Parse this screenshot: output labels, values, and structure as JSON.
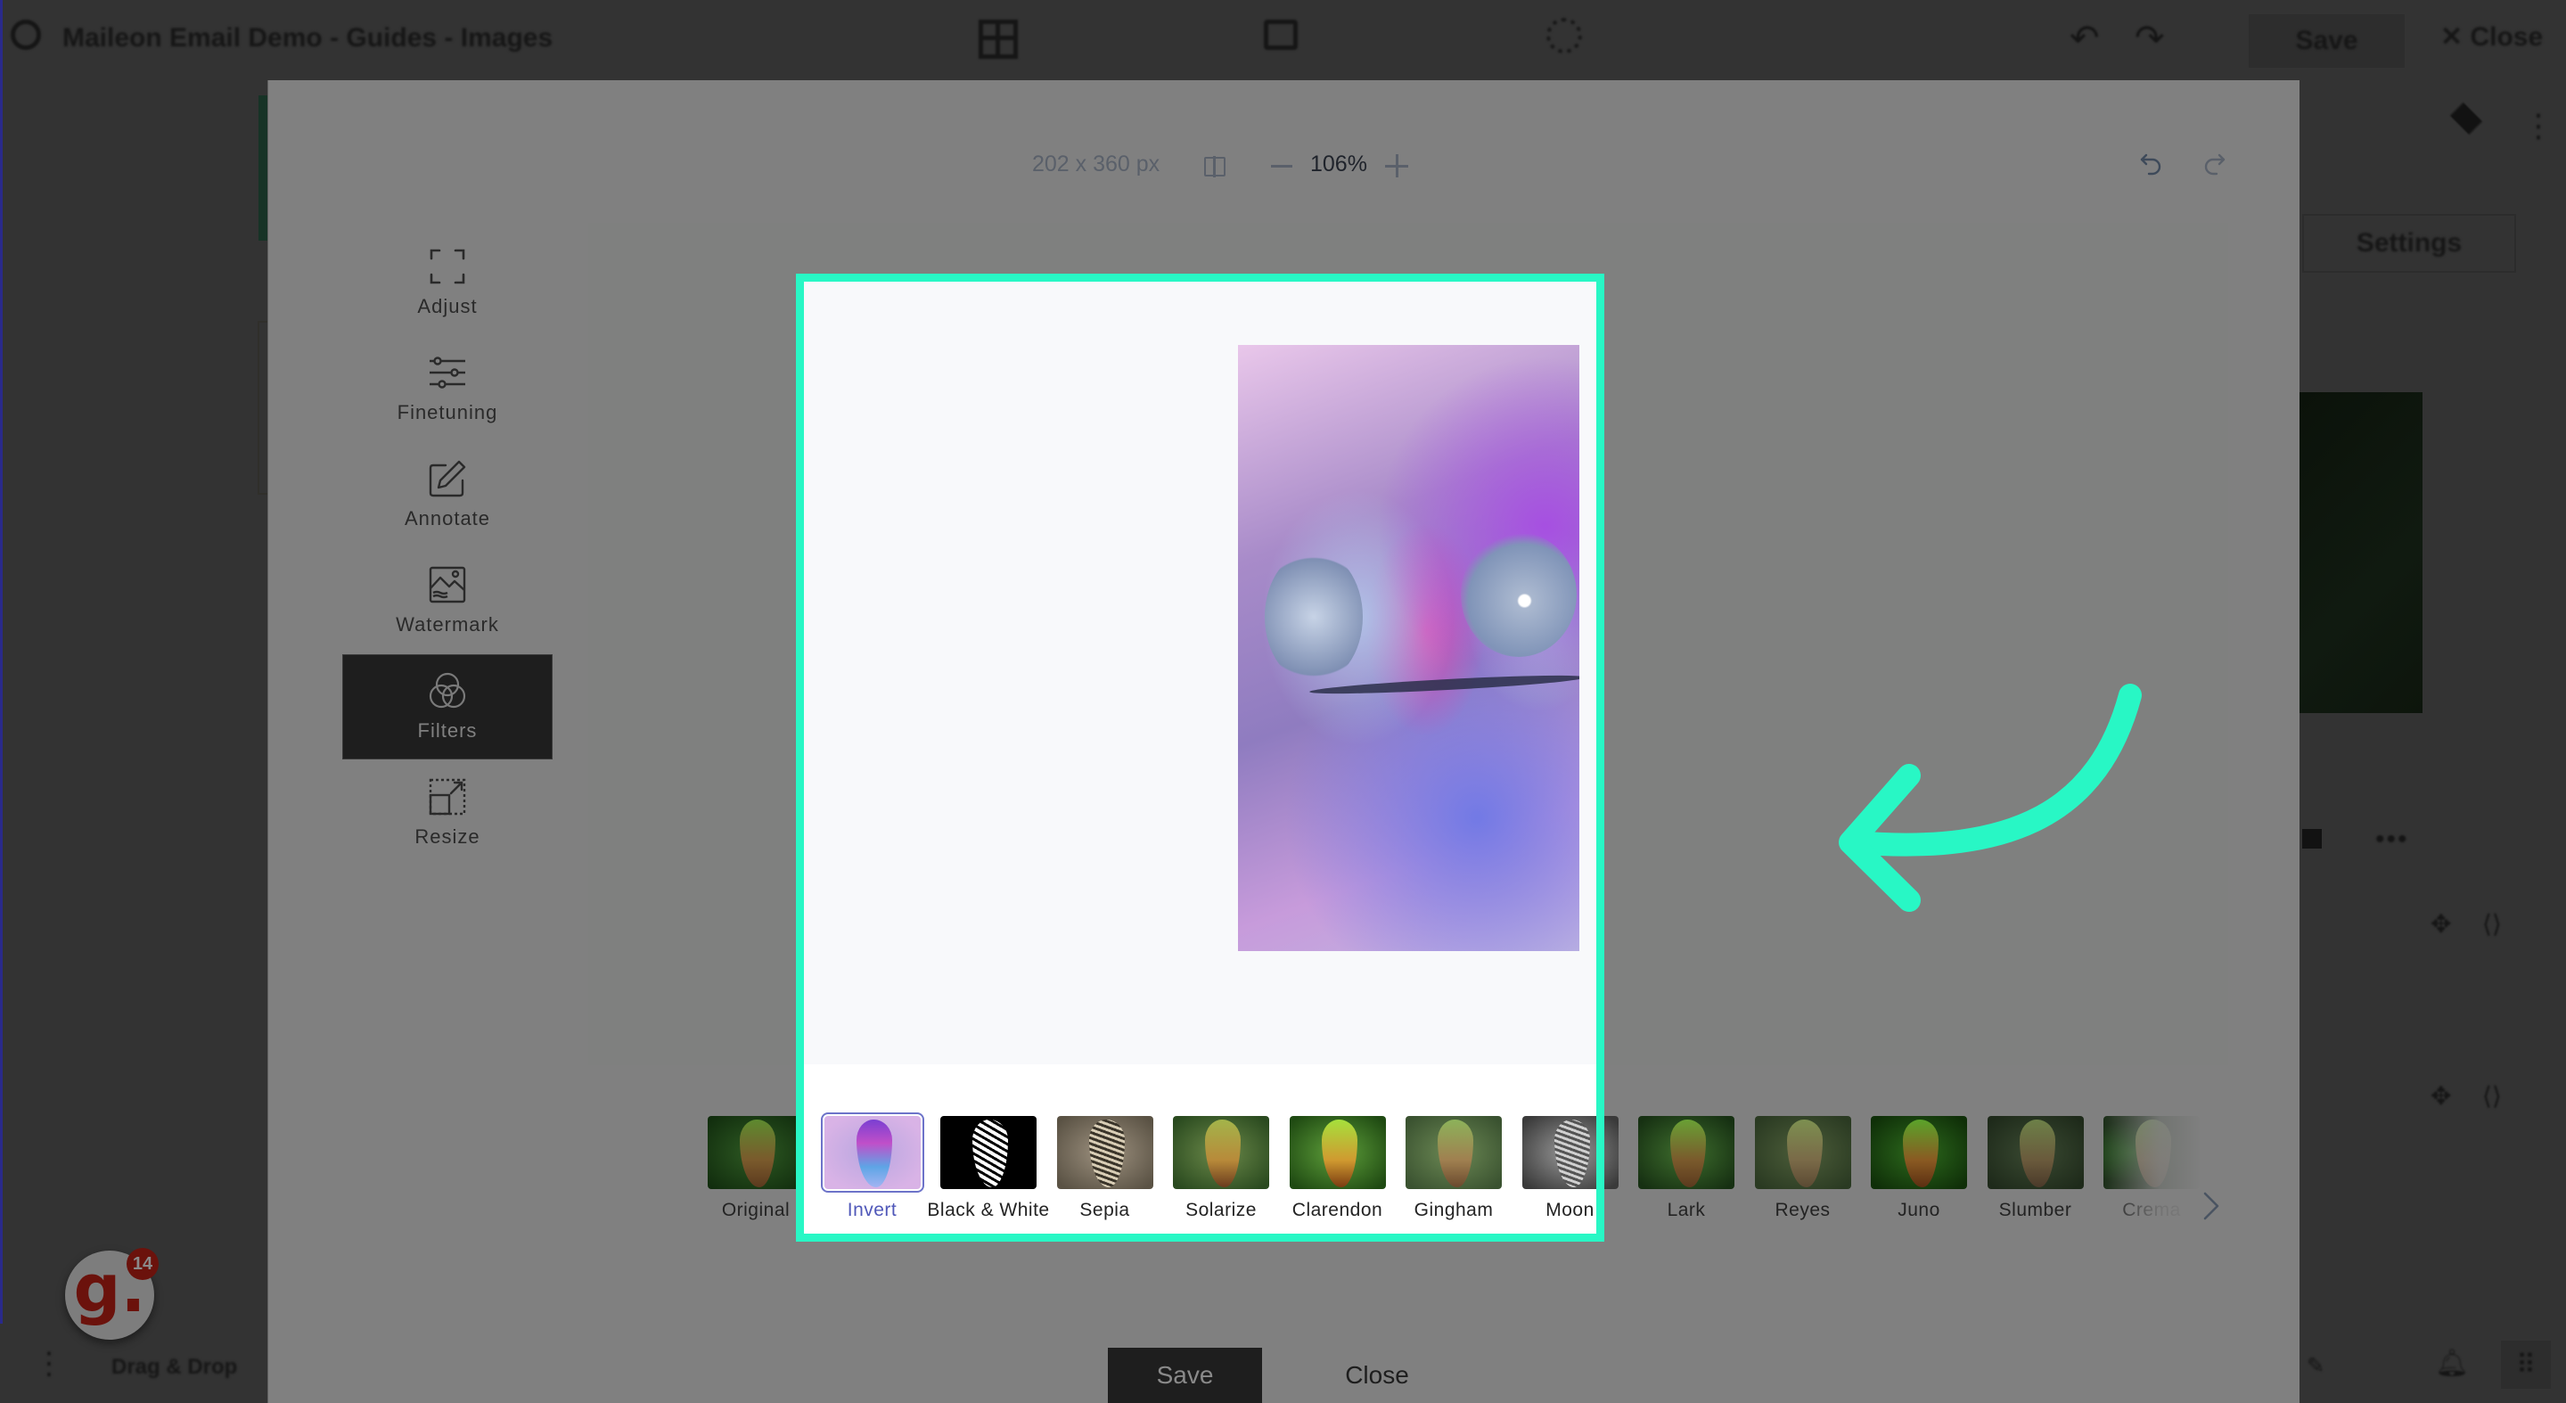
{
  "app": {
    "title": "Maileon Email Demo - Guides - Images",
    "save_label": "Save",
    "close_label": "✕ Close",
    "settings_label": "Settings",
    "bottom_bar_label": "Drag & Drop",
    "icons": {
      "logo": "maileon-logo-icon",
      "layout": "layout-grid-icon",
      "desktop": "desktop-preview-icon",
      "gear": "settings-gear-icon",
      "undo": "undo-icon",
      "redo": "redo-icon",
      "layers": "layers-icon",
      "more": "more-vertical-icon",
      "pen": "pen-icon",
      "bell": "bell-icon",
      "apps": "apps-grid-icon"
    }
  },
  "badge": {
    "letter": "g.",
    "count": "14",
    "color": "#6b120c"
  },
  "editor": {
    "image_dimensions": "202 x 360 px",
    "zoom_level": "106%",
    "tools": [
      {
        "id": "adjust",
        "label": "Adjust",
        "icon": "crop-frame-icon",
        "active": false
      },
      {
        "id": "finetuning",
        "label": "Finetuning",
        "icon": "sliders-icon",
        "active": false
      },
      {
        "id": "annotate",
        "label": "Annotate",
        "icon": "pencil-edit-icon",
        "active": false
      },
      {
        "id": "watermark",
        "label": "Watermark",
        "icon": "image-landscape-icon",
        "active": false
      },
      {
        "id": "filters",
        "label": "Filters",
        "icon": "venn-circles-icon",
        "active": true
      },
      {
        "id": "resize",
        "label": "Resize",
        "icon": "resize-icon",
        "active": false
      }
    ],
    "filters": [
      {
        "label": "Original",
        "selected": false
      },
      {
        "label": "Invert",
        "selected": true
      },
      {
        "label": "Black & White",
        "selected": false
      },
      {
        "label": "Sepia",
        "selected": false
      },
      {
        "label": "Solarize",
        "selected": false
      },
      {
        "label": "Clarendon",
        "selected": false
      },
      {
        "label": "Gingham",
        "selected": false
      },
      {
        "label": "Moon",
        "selected": false
      },
      {
        "label": "Lark",
        "selected": false
      },
      {
        "label": "Reyes",
        "selected": false
      },
      {
        "label": "Juno",
        "selected": false
      },
      {
        "label": "Slumber",
        "selected": false
      },
      {
        "label": "Crema",
        "selected": false
      }
    ],
    "save_label": "Save",
    "close_label": "Close"
  },
  "annotation": {
    "highlight_color": "#28F7C5"
  }
}
